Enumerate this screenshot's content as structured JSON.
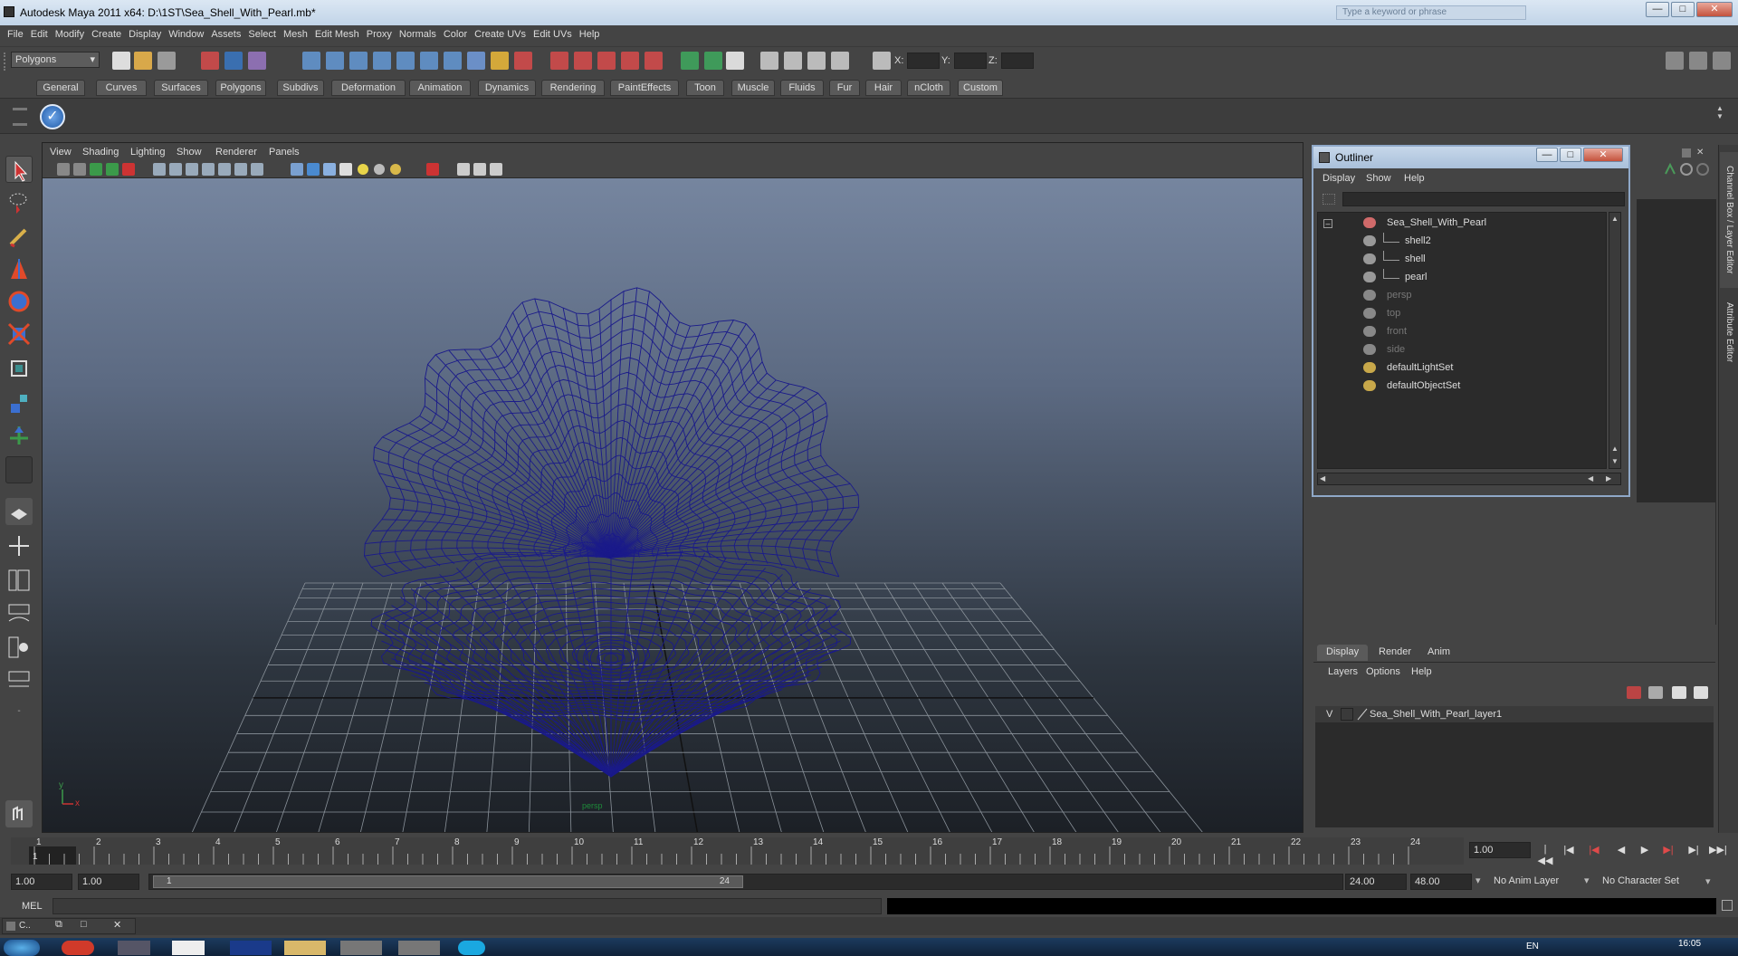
{
  "window": {
    "title": "Autodesk Maya 2011 x64: D:\\1ST\\Sea_Shell_With_Pearl.mb*",
    "search_placeholder": "Type a keyword or phrase",
    "minimize": "—",
    "maximize": "□",
    "close": "✕"
  },
  "menubar": [
    "File",
    "Edit",
    "Modify",
    "Create",
    "Display",
    "Window",
    "Assets",
    "Select",
    "Mesh",
    "Edit Mesh",
    "Proxy",
    "Normals",
    "Color",
    "Create UVs",
    "Edit UVs",
    "Help"
  ],
  "status_line": {
    "menu_set": "Polygons",
    "x_label": "X:",
    "y_label": "Y:",
    "z_label": "Z:"
  },
  "shelf_tabs": [
    "General",
    "Curves",
    "Surfaces",
    "Polygons",
    "Subdivs",
    "Deformation",
    "Animation",
    "Dynamics",
    "Rendering",
    "PaintEffects",
    "Toon",
    "Muscle",
    "Fluids",
    "Fur",
    "Hair",
    "nCloth",
    "Custom"
  ],
  "shelf_active_tab": "Custom",
  "viewport": {
    "menu": [
      "View",
      "Shading",
      "Lighting",
      "Show",
      "Renderer",
      "Panels"
    ],
    "camera_label": "persp",
    "axis_x": "x",
    "axis_y": "y",
    "wire_color": "#1a1a8a"
  },
  "outliner": {
    "title": "Outliner",
    "menu": [
      "Display",
      "Show",
      "Help"
    ],
    "items": [
      {
        "label": "Sea_Shell_With_Pearl",
        "level": 0,
        "dim": false,
        "icon": "transform-icon"
      },
      {
        "label": "shell2",
        "level": 1,
        "dim": false,
        "icon": "mesh-icon"
      },
      {
        "label": "shell",
        "level": 1,
        "dim": false,
        "icon": "mesh-icon"
      },
      {
        "label": "pearl",
        "level": 1,
        "dim": false,
        "icon": "mesh-icon"
      },
      {
        "label": "persp",
        "level": 0,
        "dim": true,
        "icon": "camera-icon"
      },
      {
        "label": "top",
        "level": 0,
        "dim": true,
        "icon": "camera-icon"
      },
      {
        "label": "front",
        "level": 0,
        "dim": true,
        "icon": "camera-icon"
      },
      {
        "label": "side",
        "level": 0,
        "dim": true,
        "icon": "camera-icon"
      },
      {
        "label": "defaultLightSet",
        "level": 0,
        "dim": false,
        "icon": "set-icon"
      },
      {
        "label": "defaultObjectSet",
        "level": 0,
        "dim": false,
        "icon": "set-icon"
      }
    ]
  },
  "side_tabs": [
    "Channel Box / Layer Editor",
    "Attribute Editor"
  ],
  "layer_editor": {
    "tabs": [
      "Display",
      "Render",
      "Anim"
    ],
    "menu": [
      "Layers",
      "Options",
      "Help"
    ],
    "layer_visibility": "V",
    "layer_name": "Sea_Shell_With_Pearl_layer1"
  },
  "time_slider": {
    "ticks": [
      "1",
      "2",
      "3",
      "4",
      "5",
      "6",
      "7",
      "8",
      "9",
      "10",
      "11",
      "12",
      "13",
      "14",
      "15",
      "16",
      "17",
      "18",
      "19",
      "20",
      "21",
      "22",
      "23",
      "24"
    ],
    "current_frame": "1",
    "current_time_field": "1.00"
  },
  "range_slider": {
    "start_time": "1.00",
    "playback_start": "1.00",
    "range_start_label": "1",
    "range_end_label": "24",
    "playback_end": "24.00",
    "end_time": "48.00",
    "anim_layer": "No Anim Layer",
    "character_set": "No Character Set"
  },
  "command_line": {
    "label": "MEL"
  },
  "taskbar": {
    "task_label": "C..",
    "time": "16:05",
    "lang": "EN"
  }
}
